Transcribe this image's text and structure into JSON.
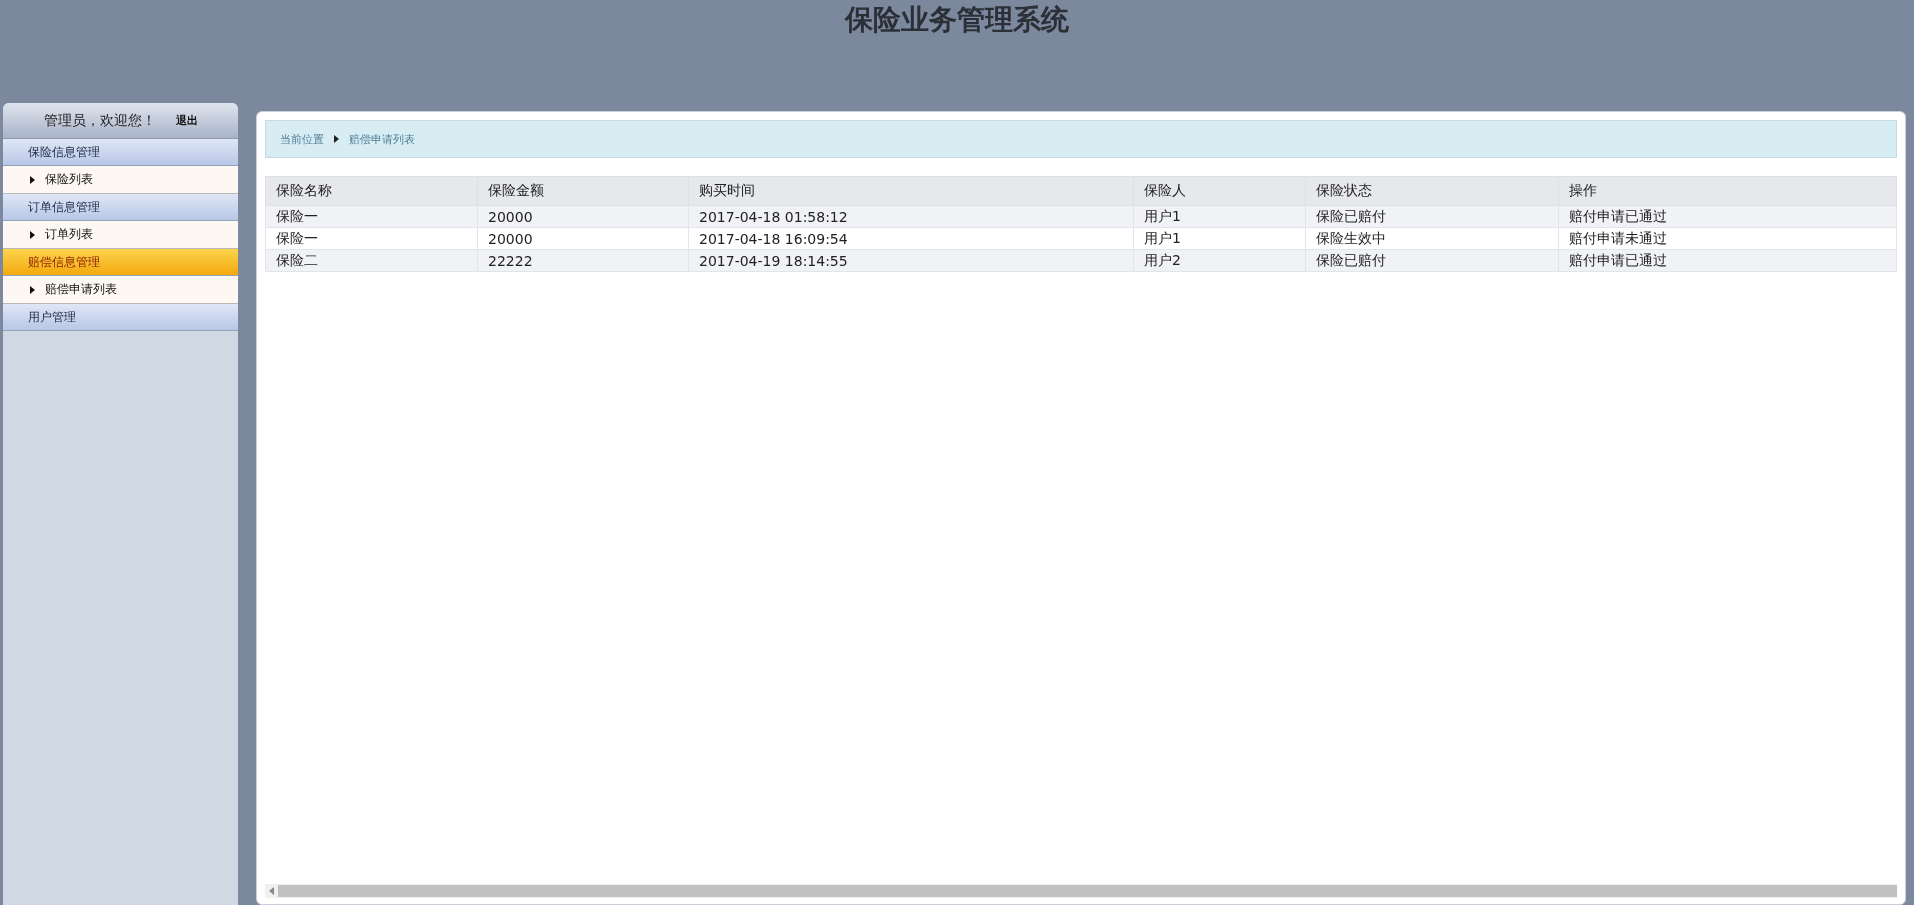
{
  "header": {
    "title": "保险业务管理系统"
  },
  "sidebar": {
    "welcome": "管理员，欢迎您！",
    "logout": "退出",
    "groups": [
      {
        "label": "保险信息管理",
        "selected": false,
        "children": [
          {
            "label": "保险列表"
          }
        ]
      },
      {
        "label": "订单信息管理",
        "selected": false,
        "children": [
          {
            "label": "订单列表"
          }
        ]
      },
      {
        "label": "赔偿信息管理",
        "selected": true,
        "children": [
          {
            "label": "赔偿申请列表"
          }
        ]
      },
      {
        "label": "用户管理",
        "selected": false
      }
    ]
  },
  "breadcrumb": [
    "当前位置",
    "赔偿申请列表"
  ],
  "table": {
    "columns": [
      "保险名称",
      "保险金额",
      "购买时间",
      "保险人",
      "保险状态",
      "操作"
    ],
    "rows": [
      [
        "保险一",
        "20000",
        "2017-04-18 01:58:12",
        "用户1",
        "保险已赔付",
        "赔付申请已通过"
      ],
      [
        "保险一",
        "20000",
        "2017-04-18 16:09:54",
        "用户1",
        "保险生效中",
        "赔付申请未通过"
      ],
      [
        "保险二",
        "22222",
        "2017-04-19 18:14:55",
        "用户2",
        "保险已赔付",
        "赔付申请已通过"
      ]
    ]
  }
}
